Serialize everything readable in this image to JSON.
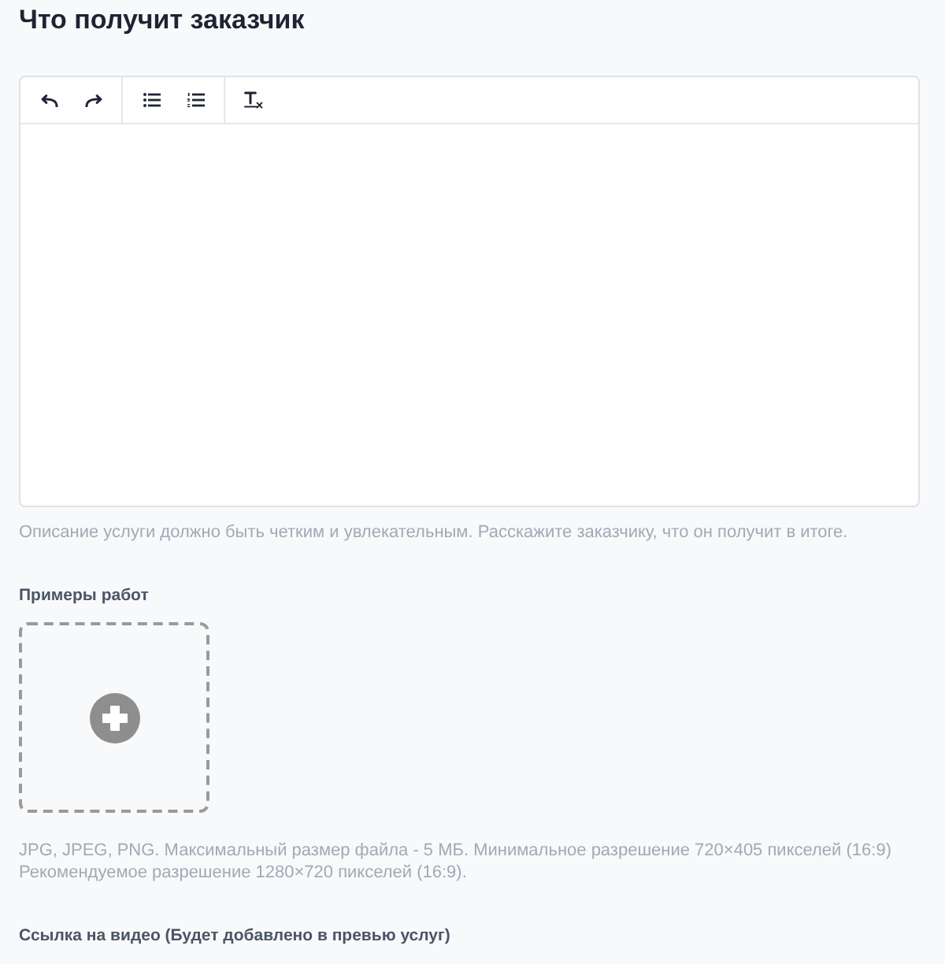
{
  "title": "Что получит заказчик",
  "description": {
    "hint": "Описание услуги должно быть четким и увлекательным. Расскажите заказчику, что он получит в итоге."
  },
  "examples": {
    "label": "Примеры работ",
    "hint_lines": [
      "JPG, JPEG, PNG. Максимальный размер файла - 5 МБ. Минимальное разрешение 720×405 пикселей (16:9)",
      "Рекомендуемое разрешение 1280×720 пикселей (16:9)."
    ]
  },
  "video": {
    "label": "Ссылка на видео (Будет добавлено в превью услуг)"
  }
}
